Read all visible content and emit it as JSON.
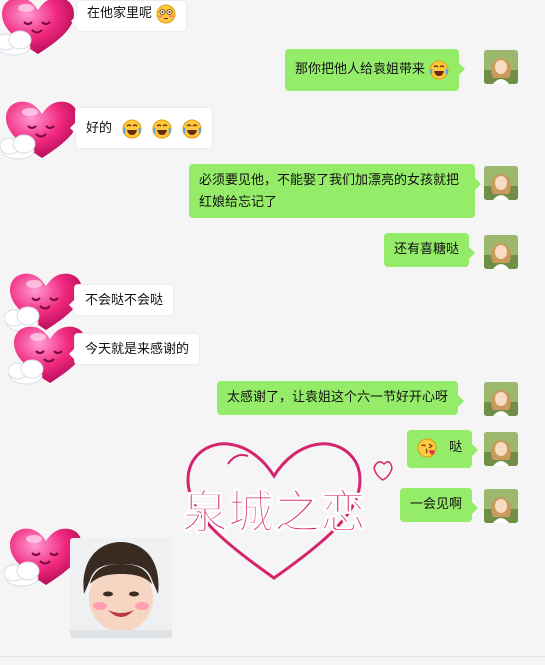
{
  "messages": [
    {
      "side": "left",
      "text": "在他家里呢",
      "emoji": [
        "flushed-emoji"
      ]
    },
    {
      "side": "right",
      "text": "那你把他人给袁姐带来",
      "emoji": [
        "laughing-tears-emoji"
      ]
    },
    {
      "side": "left",
      "text": "好的",
      "emoji": [
        "laughing-tears-emoji",
        "laughing-tears-emoji",
        "laughing-tears-emoji"
      ]
    },
    {
      "side": "right",
      "text": "必须要见他，不能娶了我们加漂亮的女孩就把红娘给忘记了",
      "emoji": []
    },
    {
      "side": "right",
      "text": "还有喜糖哒",
      "emoji": []
    },
    {
      "side": "left",
      "text": "不会哒不会哒",
      "emoji": []
    },
    {
      "side": "left",
      "text": "今天就是来感谢的",
      "emoji": []
    },
    {
      "side": "right",
      "text": "太感谢了，让袁姐这个六一节好开心呀",
      "emoji": []
    },
    {
      "side": "right",
      "text": "哒",
      "emoji": [
        "kissing-heart-emoji"
      ]
    },
    {
      "side": "right",
      "text": "一会见啊",
      "emoji": []
    }
  ],
  "watermark": {
    "text": "泉城之恋"
  },
  "icons": {
    "left_avatar": "heart-cloud-icon",
    "right_avatar": "user-avatar-icon",
    "photo": "child-photo-sticker"
  },
  "colors": {
    "sent": "#95ec69",
    "received": "#ffffff",
    "background": "#f5f5f5",
    "watermark": "#d4246e"
  }
}
